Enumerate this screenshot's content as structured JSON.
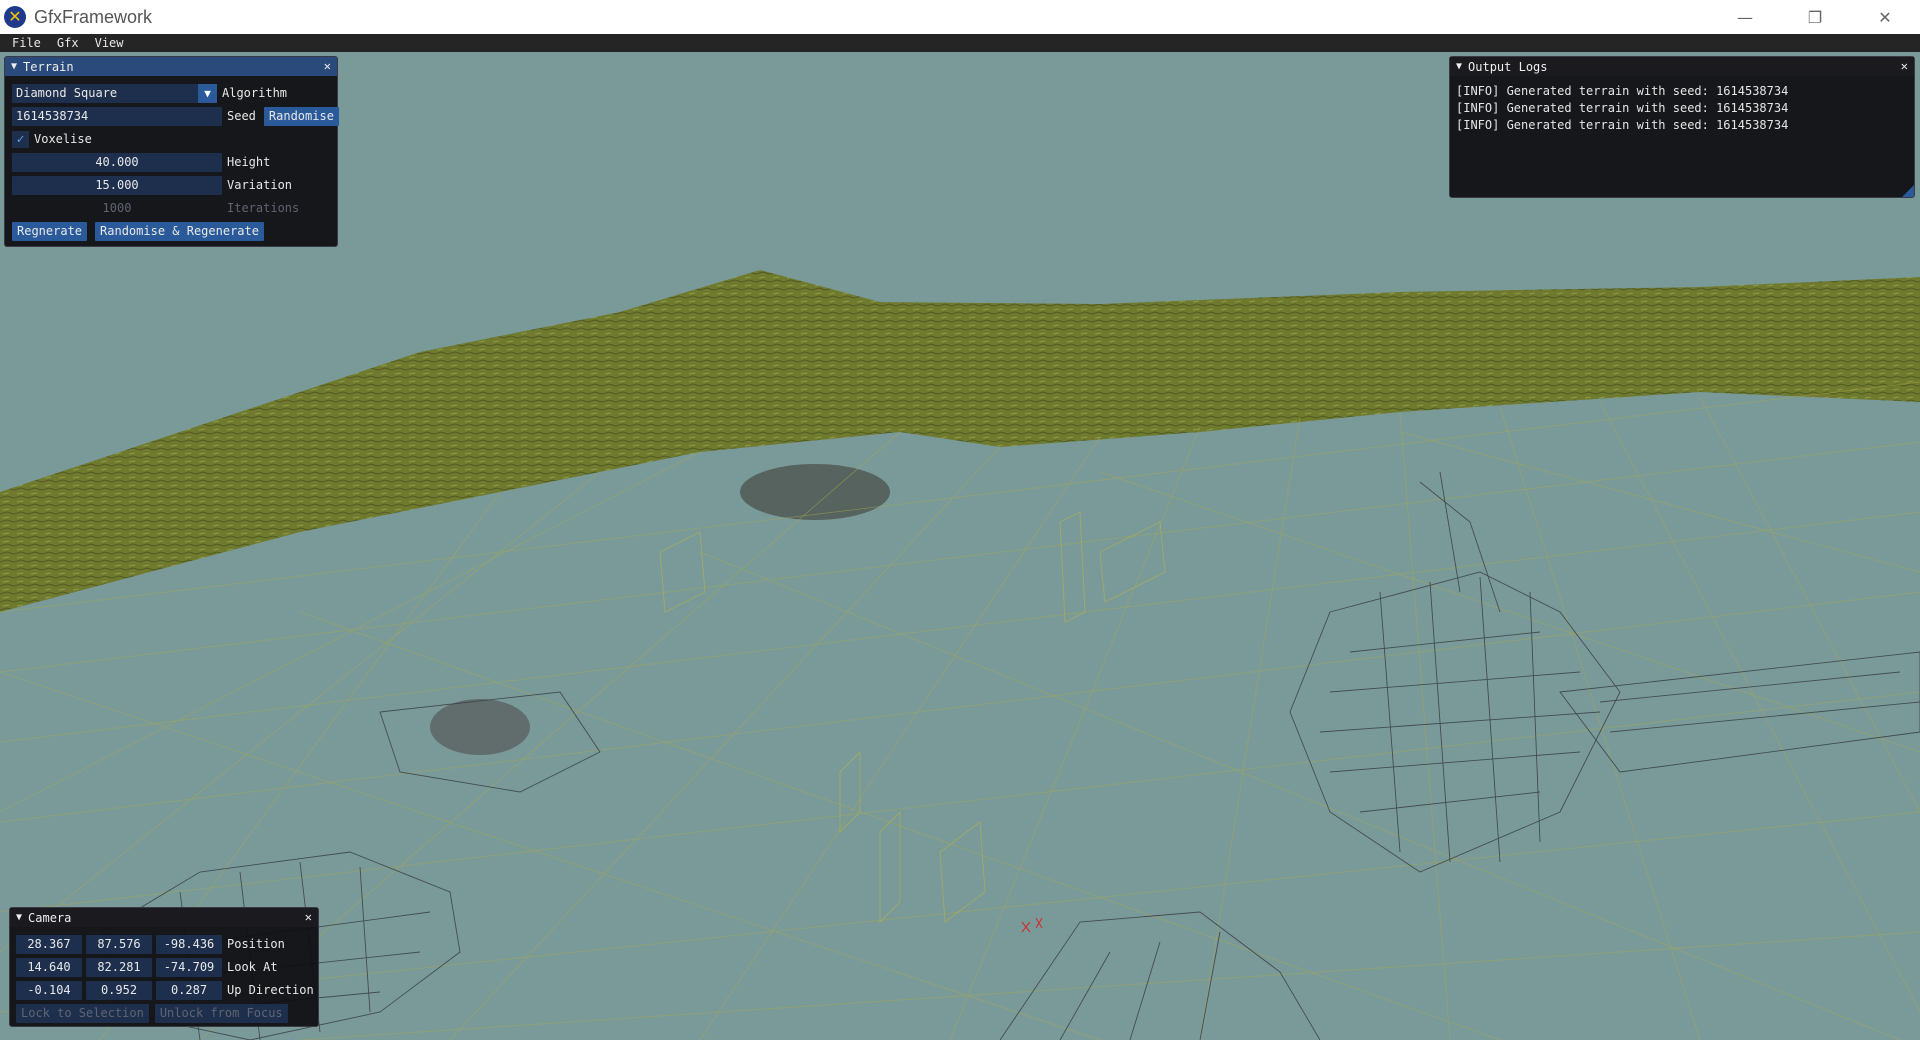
{
  "window": {
    "title": "GfxFramework",
    "controls": {
      "minimize_icon": "minimize-icon",
      "restore_icon": "restore-icon",
      "close_icon": "close-icon"
    }
  },
  "menubar": {
    "items": [
      "File",
      "Gfx",
      "View"
    ]
  },
  "terrain_panel": {
    "title": "Terrain",
    "algorithm_value": "Diamond Square",
    "algorithm_label": "Algorithm",
    "seed_value": "1614538734",
    "seed_label": "Seed",
    "randomise_label": "Randomise",
    "voxelise_label": "Voxelise",
    "voxelise_checked": true,
    "height_value": "40.000",
    "height_label": "Height",
    "variation_value": "15.000",
    "variation_label": "Variation",
    "iterations_value": "1000",
    "iterations_label": "Iterations",
    "regenerate_label": "Regnerate",
    "randomise_regenerate_label": "Randomise & Regenerate"
  },
  "output_logs": {
    "title": "Output Logs",
    "lines": [
      "[INFO] Generated terrain with seed: 1614538734",
      "[INFO] Generated terrain with seed: 1614538734",
      "[INFO] Generated terrain with seed: 1614538734"
    ]
  },
  "camera_panel": {
    "title": "Camera",
    "position": [
      "28.367",
      "87.576",
      "-98.436"
    ],
    "position_label": "Position",
    "look_at": [
      "14.640",
      "82.281",
      "-74.709"
    ],
    "look_at_label": "Look At",
    "up_direction": [
      "-0.104",
      "0.952",
      "0.287"
    ],
    "up_direction_label": "Up Direction",
    "lock_label": "Lock to Selection",
    "unlock_label": "Unlock from Focus"
  },
  "colors": {
    "background": "#7a9a9a",
    "terrain_fill": "#6f7a2e",
    "wire": "#a8a84a",
    "header": "#294a7a",
    "button": "#2a5a9a"
  }
}
